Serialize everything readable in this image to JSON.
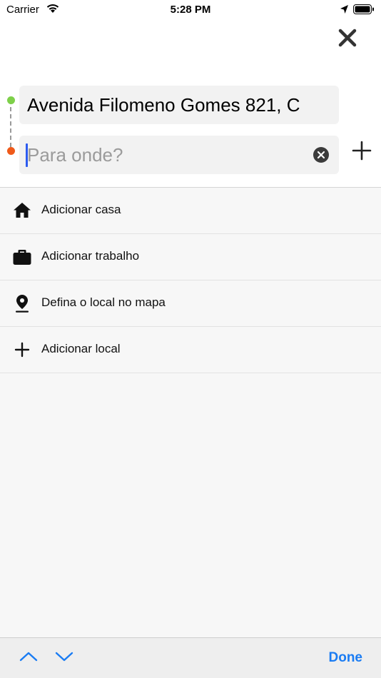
{
  "status_bar": {
    "carrier": "Carrier",
    "time": "5:28 PM"
  },
  "route": {
    "origin_value": "Avenida Filomeno Gomes 821, C",
    "destination_value": "",
    "destination_placeholder": "Para onde?",
    "origin_dot_color": "#7ed04a",
    "destination_dot_color": "#ef5a1a"
  },
  "places": [
    {
      "label": "Adicionar casa",
      "icon": "home-icon"
    },
    {
      "label": "Adicionar trabalho",
      "icon": "briefcase-icon"
    },
    {
      "label": "Defina o local no mapa",
      "icon": "map-pin-icon"
    },
    {
      "label": "Adicionar local",
      "icon": "plus-icon"
    }
  ],
  "toolbar": {
    "done_label": "Done",
    "accent_color": "#1a7cf3"
  }
}
